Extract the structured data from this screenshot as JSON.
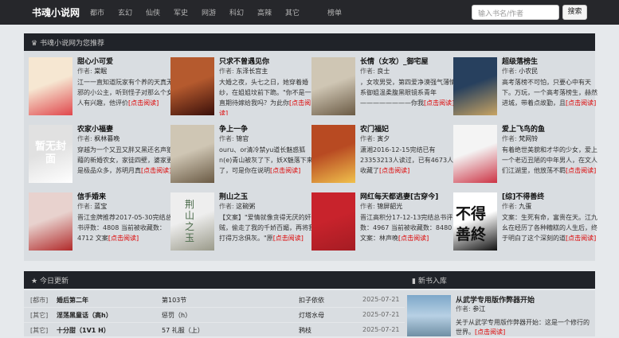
{
  "nav": {
    "brand": "书魂小说网",
    "items": [
      "都市",
      "玄幻",
      "仙侠",
      "军史",
      "网游",
      "科幻",
      "高辣",
      "其它",
      "榜单"
    ]
  },
  "search": {
    "placeholder": "输入书名/作者",
    "button": "搜索"
  },
  "recommend": {
    "title": "书魂小说网为您推荐",
    "author_label": "作者: ",
    "books": [
      {
        "title": "甜心小可爱",
        "author": "棠眠",
        "desc": "江一一直知道阮家有个养的天真无邪的小公主，听到怪子对那么个女人有兴趣，他评价",
        "link": "[点击阅读]",
        "cover_colors": [
          "#f6e7d2",
          "#e0474c"
        ]
      },
      {
        "title": "只求不曾遇见你",
        "author": "东泽长宫主",
        "desc": "大婚之夜，头七之日，她穿着婚纱，在姐姐坟前下跪。\"你不是一直期待嫁给我吗？为此你",
        "link": "[点击阅读]",
        "cover_colors": [
          "#b55a2e",
          "#3a0f0a"
        ]
      },
      {
        "title": "长情（女攻）_御宅屋",
        "author": "良士",
        "desc": "，女攻男受，第四爱净漠强气薄情系御姐温柔腹黑眼镜系青年————————你我",
        "link": "[点击阅读]",
        "cover_colors": [
          "#cfc6b4",
          "#6a5a44"
        ]
      },
      {
        "title": "超级落榜生",
        "author": "小农民",
        "desc": "高考落榜不可怕，只要心中有天下。万玩，一个高考落榜生，赫然进城，带着点故勤，且",
        "link": "[点击阅读]",
        "cover_colors": [
          "#27405e",
          "#c8a463"
        ]
      },
      {
        "title": "农家小福妻",
        "author": "枫林暮晚",
        "desc": "穿越为一个又丑又胖又黑还名声狼藉的新婚农女，家徒四壁，婆家更是极品众多，苏明月真",
        "link": "[点击阅读]",
        "cover_colors": [
          "#e1e1e1",
          "#ffffff"
        ]
      },
      {
        "title": "争上一争",
        "author": "锦官",
        "desc": "ouru、or清冷禁yu道长魅惑狐n(e)青山被灰了下，妖X魅落下来了，可是你在说明",
        "link": "[点击阅读]",
        "cover_colors": [
          "#cfc6b4",
          "#6a5a44"
        ]
      },
      {
        "title": "农门福妃",
        "author": "寅夕",
        "desc": "潇湘2016-12-15完结已有23353213人读过，已有4673人收藏了",
        "link": "[点击阅读]",
        "cover_colors": [
          "#b84a22",
          "#f0c14c"
        ]
      },
      {
        "title": "爱上飞鸟的鱼",
        "author": "梵网铃",
        "desc": "有着绝世美貌和才华的少女，爱上一个老迈丑陋的中年男人，在文人们江湖里，他放荡不羁",
        "link": "[点击阅读]",
        "cover_colors": [
          "#f4f4f4",
          "#cc3344"
        ]
      },
      {
        "title": "信手婚来",
        "author": "蓝宝",
        "desc": "晋江金牌推荐2017-05-30完结总书评数：4808 当前被收藏数：4712 文案",
        "link": "[点击阅读]",
        "cover_colors": [
          "#e8d2ce",
          "#b12a2a"
        ]
      },
      {
        "title": "荆山之玉",
        "author": "这碗粥",
        "desc": "【文案】\"爱情就像贪得无厌的奸贼，偷走了我的千娇百媚，再将我打得万念俱灰。\"原",
        "link": "[点击阅读]",
        "cover_colors": [
          "#eeeeee",
          "#9a9a8a"
        ]
      },
      {
        "title": "网红每天都逃妻[古穿今]",
        "author": "锦屏韶光",
        "desc": "晋江高积分17-12-13完结总书评数：4967 当前被收藏数：8480文案：林声晚",
        "link": "[点击阅读]",
        "cover_colors": [
          "#c8232c",
          "#a51c23"
        ]
      },
      {
        "title": "[综]不得善终",
        "author": "九蛋",
        "desc": "文案：生死有命，富贵在天。江九幺在经历了各种糟糕的人生后，终于明白了这个深刻的道",
        "link": "[点击阅读]",
        "cover_colors": [
          "#ffffff",
          "#111111"
        ]
      }
    ]
  },
  "cover_text": {
    "b4": "暂无封面",
    "b10": "荆山之玉",
    "b12a": "不得",
    "b12b": "善終"
  },
  "updates": {
    "title": "今日更新",
    "rows": [
      {
        "cat": "[都市]",
        "book": "婚后第二年",
        "chapter": "第103节",
        "author": "扣子依依",
        "date": "2025-07-21"
      },
      {
        "cat": "[其它]",
        "book": "淫荡黑童话（高h）",
        "chapter": "惩罚（h）",
        "author": "灯塔水母",
        "date": "2025-07-21"
      },
      {
        "cat": "[其它]",
        "book": "十分甜（1V1 H）",
        "chapter": "57 礼服（上）",
        "author": "鸦枝",
        "date": "2025-07-21"
      }
    ]
  },
  "newbooks": {
    "title": "新书入库",
    "book_title": "从武学专用版作弊器开始",
    "author_label": "作者: ",
    "author": "参江",
    "desc": "关于从武学专用版作弊器开始：这是一个修行的世界。",
    "link": "[点击阅读]"
  },
  "colors": {
    "nav_bg": "#26272b",
    "panel_bg": "#d9dde1",
    "head_bg": "#202329",
    "link_red": "#dd0000"
  }
}
